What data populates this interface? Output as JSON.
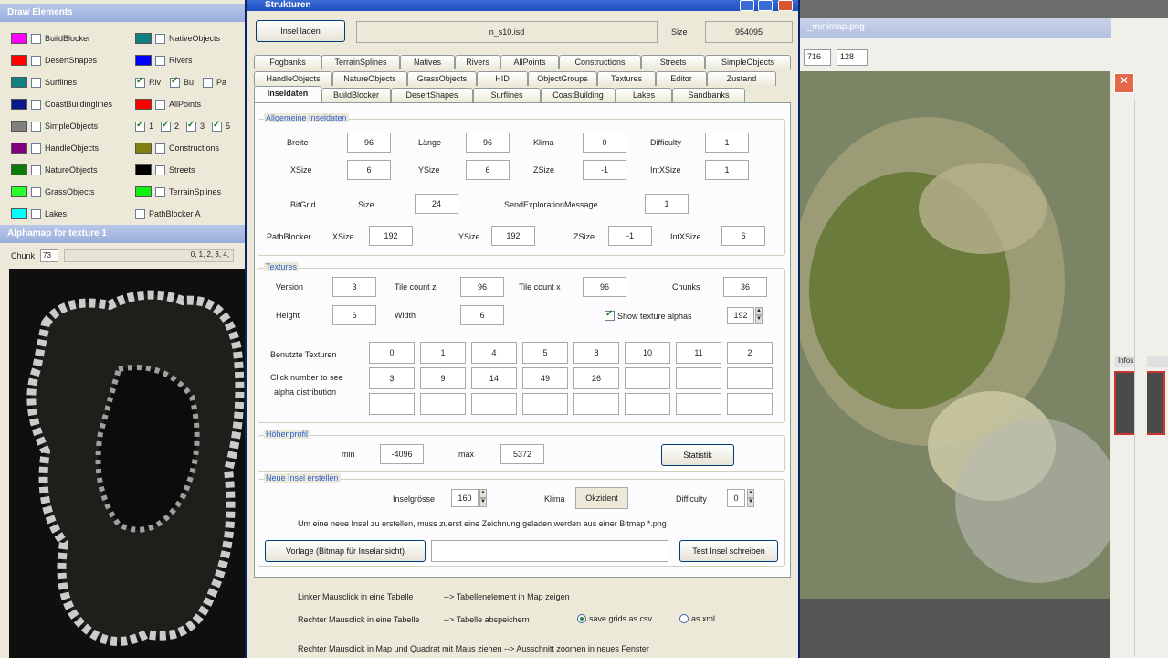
{
  "left_panel": {
    "title": "Draw Elements",
    "legend_left": [
      {
        "label": "BuildBlocker",
        "color": "#ff00ff",
        "checked": false
      },
      {
        "label": "DesertShapes",
        "color": "#ff0000",
        "checked": false
      },
      {
        "label": "Surflines",
        "color": "#118080",
        "checked": false
      },
      {
        "label": "CoastBuildinglines",
        "color": "#0a1a8a",
        "checked": false
      },
      {
        "label": "SimpleObjects",
        "color": "#808080",
        "checked": false
      },
      {
        "label": "HandleObjects",
        "color": "#800080",
        "checked": false
      },
      {
        "label": "NatureObjects",
        "color": "#0a7a0a",
        "checked": false
      },
      {
        "label": "GrassObjects",
        "color": "#2aff2a",
        "checked": false
      },
      {
        "label": "Lakes",
        "color": "#00ffff",
        "checked": false
      }
    ],
    "legend_right": [
      {
        "label": "NativeObjects",
        "color": "#118080",
        "checked": false
      },
      {
        "label": "Rivers",
        "color": "#0000ff",
        "checked": false
      },
      {
        "label": "AllPoints",
        "color": "#ff0000",
        "checked": false
      },
      {
        "label": "Constructions",
        "color": "#808010",
        "checked": false
      },
      {
        "label": "Streets",
        "color": "#000000",
        "checked": false
      },
      {
        "label": "TerrainSplines",
        "color": "#10f010",
        "checked": false
      },
      {
        "label": "PathBlocker A",
        "color": "",
        "checked": false
      }
    ],
    "row_checks": [
      {
        "label": "Riv",
        "checked": true
      },
      {
        "label": "Bu",
        "checked": true
      },
      {
        "label": "Pa",
        "checked": false
      }
    ],
    "num_checks": [
      {
        "label": "1",
        "checked": true
      },
      {
        "label": "2",
        "checked": true
      },
      {
        "label": "3",
        "checked": true
      },
      {
        "label": "5",
        "checked": true
      }
    ],
    "alphamap_title": "Alphamap for texture 1",
    "chunk_label": "Chunk",
    "chunk_value": "73",
    "chunk_list": "0, 1, 2, 3, 4,"
  },
  "dialog": {
    "title": "Strukturen",
    "load_button": "Insel laden",
    "filename": "n_s10.isd",
    "size_label": "Size",
    "size_value": "954095",
    "tabs_row1": [
      "Fogbanks",
      "TerrainSplines",
      "Natives",
      "Rivers",
      "AllPoints",
      "Constructions",
      "Streets",
      "SimpleObjects"
    ],
    "tabs_row2": [
      "HandleObjects",
      "NatureObjects",
      "GrassObjects",
      "HID",
      "ObjectGroups",
      "Textures",
      "Editor",
      "Zustand"
    ],
    "tabs_row3": [
      "Inseldaten",
      "BuildBlocker",
      "DesertShapes",
      "Surflines",
      "CoastBuilding",
      "Lakes",
      "Sandbanks"
    ],
    "general": {
      "title": "Allgemeine Inseldaten",
      "breite_label": "Breite",
      "breite": "96",
      "laenge_label": "Länge",
      "laenge": "96",
      "klima_label": "Klima",
      "klima": "0",
      "difficulty_label": "Difficulty",
      "difficulty": "1",
      "xsize_label": "XSize",
      "xsize": "6",
      "ysize_label": "YSize",
      "ysize": "6",
      "zsize_label": "ZSize",
      "zsize": "-1",
      "intxsize_label": "IntXSize",
      "intxsize": "1",
      "bitgrid_label": "BitGrid",
      "bitgrid_size_label": "Size",
      "bitgrid_size": "24",
      "sendexp_label": "SendExplorationMessage",
      "sendexp": "1",
      "pathblocker_label": "PathBlocker",
      "pb_xsize_label": "XSize",
      "pb_xsize": "192",
      "pb_ysize_label": "YSize",
      "pb_ysize": "192",
      "pb_zsize_label": "ZSize",
      "pb_zsize": "-1",
      "pb_intxsize_label": "IntXSize",
      "pb_intxsize": "6"
    },
    "textures": {
      "title": "Textures",
      "version_label": "Version",
      "version": "3",
      "tilecountz_label": "Tile count z",
      "tilecountz": "96",
      "tilecountx_label": "Tile count x",
      "tilecountx": "96",
      "chunks_label": "Chunks",
      "chunks": "36",
      "height_label": "Height",
      "height": "6",
      "width_label": "Width",
      "width": "6",
      "show_alphas_label": "Show texture alphas",
      "show_alphas_checked": true,
      "alpha_spin": "192",
      "used_label": "Benutzte Texturen",
      "click_label_1": "Click number to see",
      "click_label_2": "alpha distribution",
      "grid": [
        [
          "0",
          "1",
          "4",
          "5",
          "8",
          "10",
          "11",
          "2"
        ],
        [
          "3",
          "9",
          "14",
          "49",
          "26",
          "",
          "",
          ""
        ],
        [
          "",
          "",
          "",
          "",
          "",
          "",
          "",
          ""
        ]
      ]
    },
    "height": {
      "title": "Höhenprofil",
      "min_label": "min",
      "min": "-4096",
      "max_label": "max",
      "max": "5372",
      "stat_button": "Statistik"
    },
    "new_island": {
      "title": "Neue Insel erstellen",
      "size_label": "Inselgrösse",
      "size": "160",
      "klima_label": "Klima",
      "klima": "Okzident",
      "difficulty_label": "Difficulty",
      "difficulty": "0",
      "hint": "Um eine neue Insel zu erstellen, muss zuerst eine Zeichnung geladen werden aus einer Bitmap *.png",
      "template_button": "Vorlage (Bitmap für Inselansicht)",
      "template_path": "",
      "write_button": "Test Insel schreiben"
    },
    "help": {
      "line1_a": "Linker Mausclick in eine Tabelle",
      "line1_b": "-->  Tabellenelement in Map zeigen",
      "line2_a": "Rechter Mausclick in eine Tabelle",
      "line2_b": "--> Tabelle abspeichern",
      "radio_csv": "save grids as csv",
      "radio_xml": "as xml",
      "line3": "Rechter Mausclick in Map und Quadrat mit Maus ziehen  --> Ausschnitt zoomen in neues Fenster"
    }
  },
  "right_window": {
    "title": "_minimap.png",
    "num1": "716",
    "num2": "128",
    "info_tab": "Infos"
  }
}
